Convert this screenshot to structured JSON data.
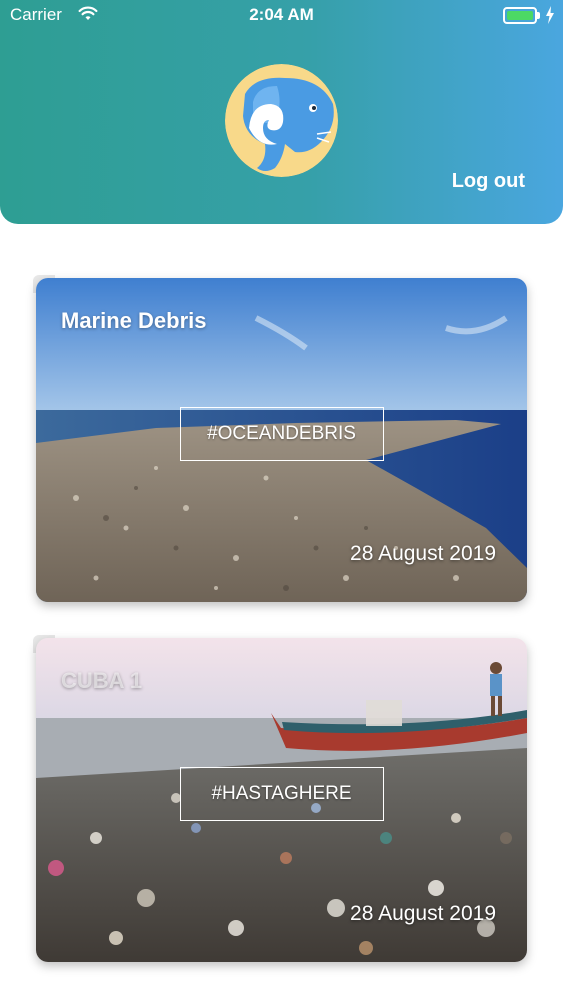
{
  "status_bar": {
    "carrier": "Carrier",
    "time": "2:04 AM",
    "battery_level": 1.0
  },
  "header": {
    "avatar_icon": "elephant-wave-logo",
    "logout_label": "Log out",
    "gradient_colors": [
      "#2e9e93",
      "#4aa6df"
    ]
  },
  "feed": {
    "cards": [
      {
        "title": "Marine Debris",
        "hashtag": "#OCEANDEBRIS",
        "date": "28 August 2019",
        "image": "ocean-debris-photo"
      },
      {
        "title": "CUBA 1",
        "hashtag": "#HASTAGHERE",
        "date": "28 August 2019",
        "image": "beach-trash-boat-photo"
      }
    ]
  }
}
